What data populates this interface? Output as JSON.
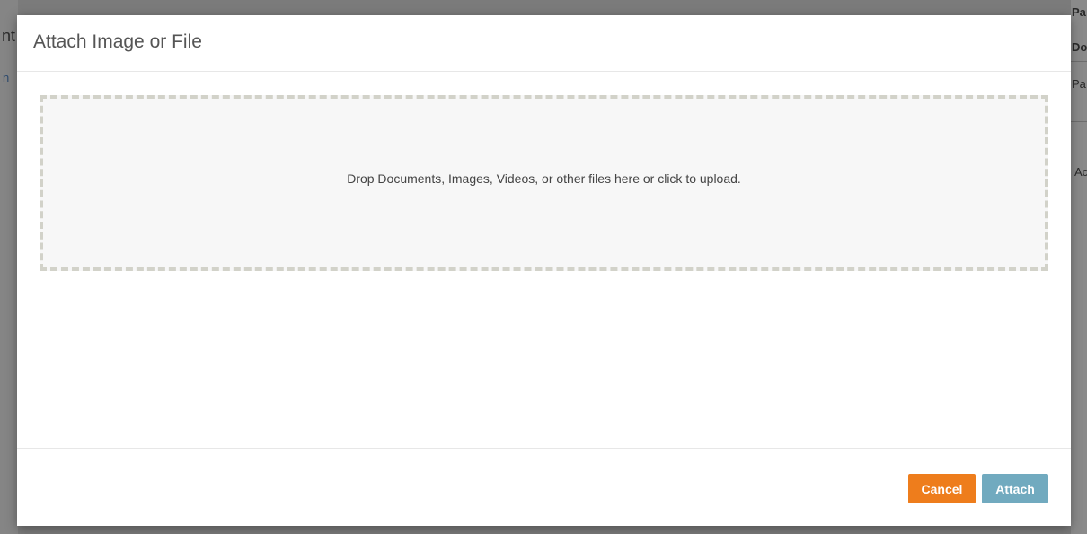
{
  "background": {
    "fragments": [
      "nt",
      "n",
      "Pa",
      "Do",
      "Pa",
      "Ac"
    ]
  },
  "modal": {
    "title": "Attach Image or File",
    "dropzone_text": "Drop Documents, Images, Videos, or other files here or click to upload.",
    "cancel_label": "Cancel",
    "attach_label": "Attach"
  },
  "colors": {
    "cancel": "#ee7d1c",
    "attach": "#71aabf",
    "dropzone_border": "#d2d2c9"
  }
}
